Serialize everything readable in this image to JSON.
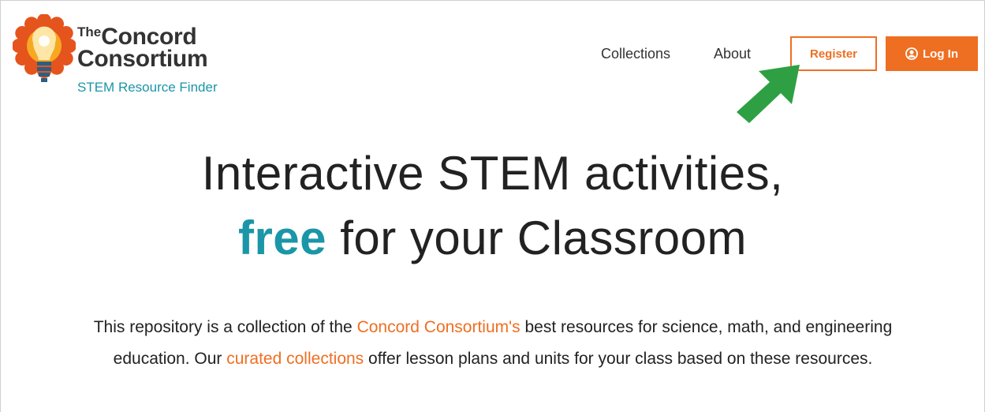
{
  "logo": {
    "the": "The",
    "concord": "Concord",
    "consortium": "Consortium",
    "subtitle": "STEM Resource Finder"
  },
  "nav": {
    "collections": "Collections",
    "about": "About",
    "register": "Register",
    "login": "Log In"
  },
  "hero": {
    "line1": "Interactive STEM activities,",
    "free": "free",
    "line2_rest": " for your Classroom"
  },
  "description": {
    "part1": "This repository is a collection of the ",
    "link1": "Concord Consortium's",
    "part2": " best resources for science, math, and engineering education. Our ",
    "link2": "curated collections",
    "part3": " offer lesson plans and units for your class based on these resources."
  },
  "colors": {
    "accent_orange": "#ef6f22",
    "brand_teal": "#1a96a8",
    "annotation_arrow": "#2ea043"
  },
  "icons": {
    "logo": "lightbulb-sun-logo",
    "login": "user-circle-icon",
    "annotation": "green-arrow-pointer"
  }
}
